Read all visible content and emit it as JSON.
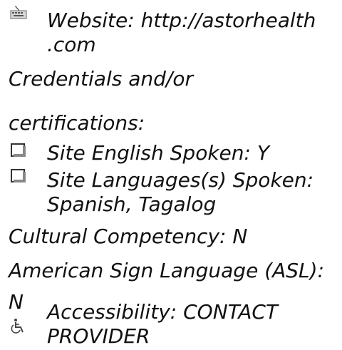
{
  "entries": {
    "website": {
      "icon": "keyboard-icon",
      "line1": "Website: http://astorhealth",
      "line2": ".com"
    },
    "credentials": {
      "line1": "Credentials and/or",
      "line2": "certifications:"
    },
    "english_spoken": {
      "icon": "checkbox-icon",
      "text": "Site English Spoken: Y"
    },
    "languages_spoken": {
      "icon": "checkbox-icon",
      "line1": "Site Languages(s) Spoken:",
      "line2": "Spanish, Tagalog"
    },
    "cultural_competency": {
      "text": "Cultural Competency: N"
    },
    "asl": {
      "line1": "American Sign Language (ASL):",
      "line2": "N"
    },
    "accessibility": {
      "icon": "wheelchair-icon",
      "line1": "Accessibility: CONTACT",
      "line2": "PROVIDER"
    }
  }
}
